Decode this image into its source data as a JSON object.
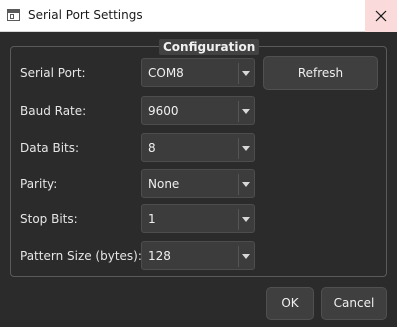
{
  "window": {
    "title": "Serial Port Settings"
  },
  "group": {
    "title": "Configuration"
  },
  "rows": [
    {
      "label": "Serial Port:",
      "value": "COM8"
    },
    {
      "label": "Baud Rate:",
      "value": "9600"
    },
    {
      "label": "Data Bits:",
      "value": "8"
    },
    {
      "label": "Parity:",
      "value": "None"
    },
    {
      "label": "Stop Bits:",
      "value": "1"
    },
    {
      "label": "Pattern Size (bytes):",
      "value": "128"
    }
  ],
  "buttons": {
    "refresh": "Refresh",
    "ok": "OK",
    "cancel": "Cancel"
  },
  "icons": {
    "app": "window-icon",
    "close": "close-icon",
    "dropdown": "chevron-down-icon"
  },
  "colors": {
    "background": "#2b2b2b",
    "control": "#3c3c3c",
    "button": "#3f3f3f",
    "close_hover": "#fadada"
  }
}
